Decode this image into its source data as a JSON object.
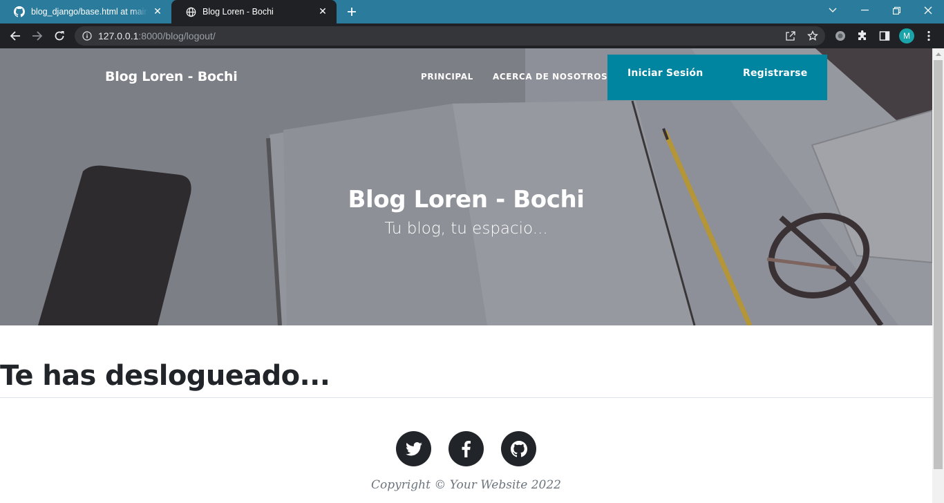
{
  "browser": {
    "tabs": [
      {
        "title": "blog_django/base.html at main · ",
        "icon": "github-icon",
        "active": false
      },
      {
        "title": "Blog Loren - Bochi",
        "icon": "globe-icon",
        "active": true
      }
    ],
    "address": {
      "host": "127.0.0.1",
      "path": ":8000/blog/logout/"
    },
    "profile_initial": "M",
    "colors": {
      "tabbar": "#2b7b9c",
      "toolbar": "#202124",
      "omnibox": "#35363a",
      "avatar": "#1aa3a8"
    }
  },
  "site": {
    "brand": "Blog Loren - Bochi",
    "nav": {
      "principal": "PRINCIPAL",
      "about": "ACERCA DE NOSOTROS",
      "login": "Iniciar Sesión",
      "register": "Registrarse"
    },
    "hero": {
      "title": "Blog Loren - Bochi",
      "subtitle": "Tu blog, tu espacio..."
    },
    "main": {
      "heading": "Te has deslogueado..."
    },
    "footer": {
      "social": [
        "twitter-icon",
        "facebook-icon",
        "github-icon"
      ],
      "copyright": "Copyright © Your Website 2022"
    },
    "colors": {
      "accent": "#0085a1",
      "dark": "#212529",
      "muted": "#6c757d"
    }
  }
}
